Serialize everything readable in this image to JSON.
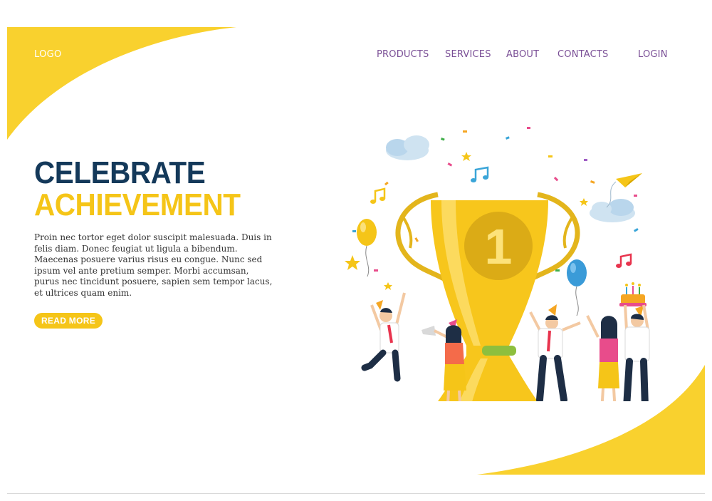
{
  "header": {
    "logo": "LOGO",
    "nav": {
      "products": "PRODUCTS",
      "services": "SERVICES",
      "about": "ABOUT",
      "contacts": "CONTACTS",
      "login": "LOGIN"
    }
  },
  "hero": {
    "title_line1": "CELEBRATE",
    "title_line2": "ACHIEVEMENT",
    "body": "Proin nec tortor eget dolor suscipit malesuada. Duis in felis diam. Donec feugiat ut ligula a bibendum. Maecenas posuere varius risus eu congue. Nunc sed ipsum vel ante pretium semper. Morbi accumsan, purus nec tincidunt posuere, sapien sem tempor lacus, et ultrices quam enim.",
    "cta": "READ MORE"
  },
  "illustration": {
    "trophy_number": "1"
  },
  "colors": {
    "accent_yellow": "#f5c518",
    "headline_navy": "#14395a",
    "nav_purple": "#7a4f96"
  }
}
